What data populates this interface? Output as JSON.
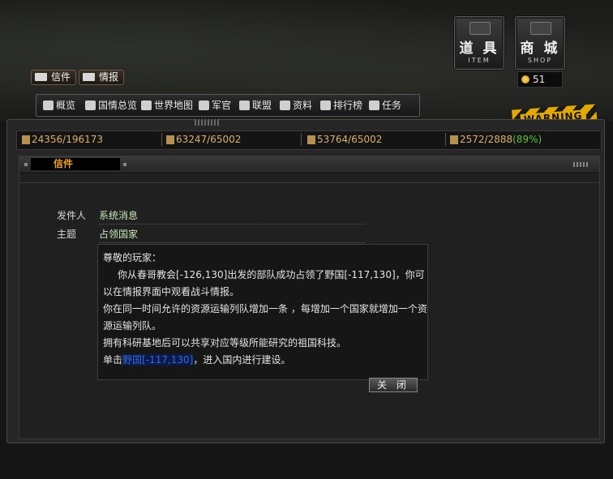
{
  "header": {
    "item_button": {
      "cn": "道 具",
      "en": "ITEM"
    },
    "shop_button": {
      "cn": "商 城",
      "en": "SHOP"
    },
    "gold": "51",
    "tabs": [
      {
        "label": "信件",
        "icon": "envelope-icon"
      },
      {
        "label": "情报",
        "icon": "report-icon"
      }
    ],
    "warning_label": "WARNING"
  },
  "nav": {
    "items": [
      {
        "label": "概览",
        "icon": "eye-icon"
      },
      {
        "label": "国情总览",
        "icon": "nation-icon"
      },
      {
        "label": "世界地图",
        "icon": "map-icon"
      },
      {
        "label": "军官",
        "icon": "officer-icon"
      },
      {
        "label": "联盟",
        "icon": "alliance-icon"
      },
      {
        "label": "资料",
        "icon": "document-icon"
      },
      {
        "label": "排行榜",
        "icon": "ranking-icon"
      },
      {
        "label": "任务",
        "icon": "star-icon"
      }
    ]
  },
  "resources": [
    {
      "text": "24356/196173",
      "icon": "gold-resource-icon"
    },
    {
      "text": "63247/65002",
      "icon": "food-resource-icon"
    },
    {
      "text": "53764/65002",
      "icon": "metal-resource-icon"
    },
    {
      "text": "2572/2888",
      "pct": "(89%)",
      "icon": "energy-resource-icon"
    }
  ],
  "panel": {
    "title": "信件",
    "sender_label": "发件人",
    "sender_value": "系统消息",
    "subject_label": "主题",
    "subject_value": "占领国家",
    "message": {
      "greeting": "尊敬的玩家：",
      "line1": "你从春哥教会[-126,130]出发的部队成功占领了野国[-117,130]，你可以在情报界面中观看战斗情报。",
      "line2": "你在同一时间允许的资源运输列队增加一条 ，每增加一个国家就增加一个资源运输列队。",
      "line3": "拥有科研基地后可以共享对应等级所能研究的祖国科技。",
      "line4_pre": "单击",
      "line4_link": "野国[-117,130]",
      "line4_post": "，进入国内进行建设。"
    },
    "close_label": "关 闭"
  },
  "colors": {
    "accent": "#f0a020",
    "resource_text": "#d8b070",
    "percent": "#5fbf3a",
    "link": "#2f6bd8"
  }
}
